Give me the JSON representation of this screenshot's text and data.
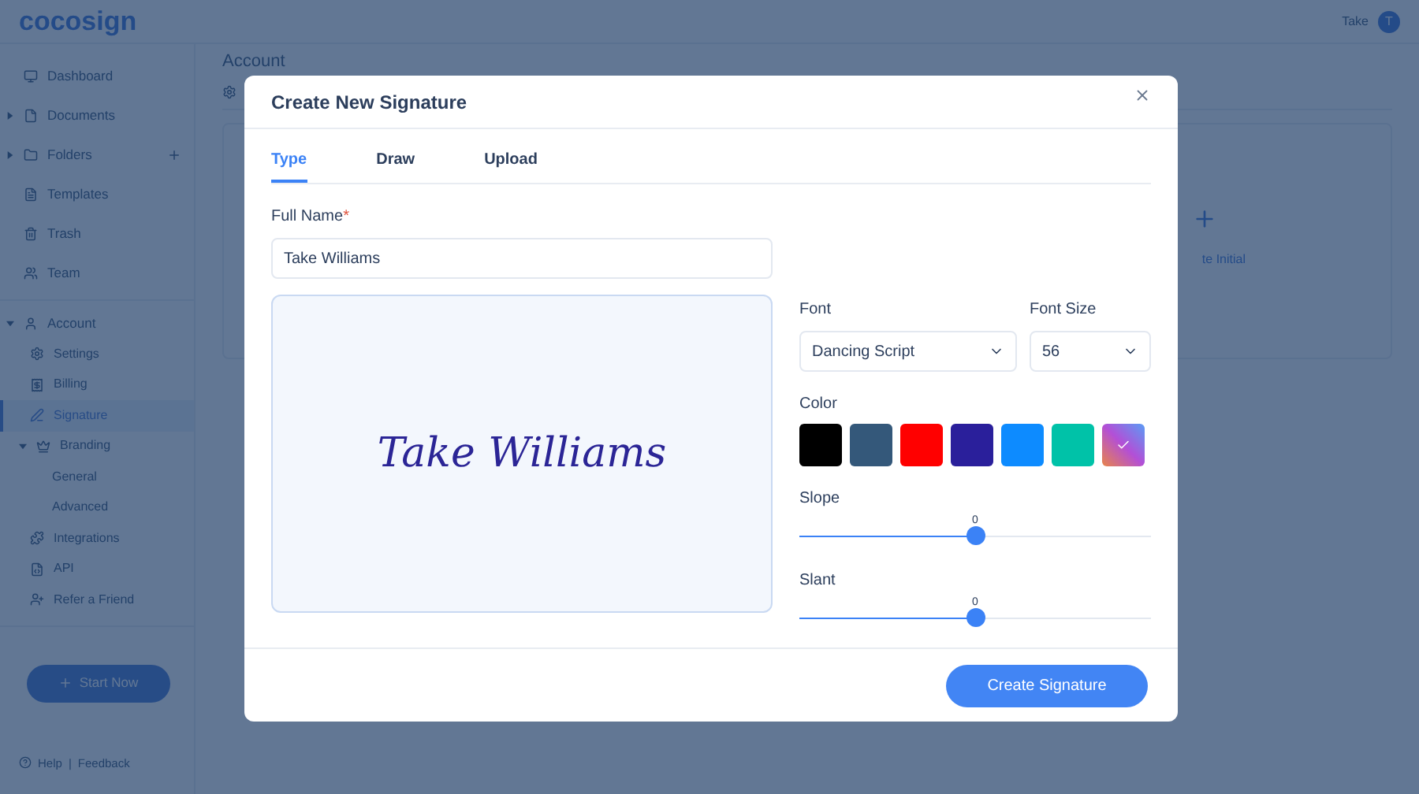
{
  "header": {
    "logo": "cocosign",
    "user_name": "Take",
    "avatar_initial": "T"
  },
  "sidebar": {
    "items": [
      {
        "label": "Dashboard",
        "selected": false
      },
      {
        "label": "Documents",
        "selected": false,
        "expanded": false
      },
      {
        "label": "Folders",
        "selected": false,
        "expanded": false,
        "add_button": true
      },
      {
        "label": "Templates",
        "selected": false
      },
      {
        "label": "Trash",
        "selected": false
      },
      {
        "label": "Team",
        "selected": false
      }
    ],
    "account": {
      "label": "Account",
      "expanded": true,
      "children": [
        {
          "label": "Settings",
          "selected": false
        },
        {
          "label": "Billing",
          "selected": false
        },
        {
          "label": "Signature",
          "selected": true
        },
        {
          "label": "Branding",
          "selected": false,
          "expanded": true,
          "children": [
            {
              "label": "General",
              "selected": false
            },
            {
              "label": "Advanced",
              "selected": false
            }
          ]
        },
        {
          "label": "Integrations",
          "selected": false
        },
        {
          "label": "API",
          "selected": false
        },
        {
          "label": "Refer a Friend",
          "selected": false
        }
      ]
    },
    "start_button": "Start Now",
    "footer_links": [
      "Help",
      "Feedback"
    ],
    "footer_separator": "|"
  },
  "page": {
    "title": "Account",
    "card_action": "te Initial"
  },
  "dialog": {
    "title": "Create New Signature",
    "tabs": [
      {
        "label": "Type",
        "selected": true
      },
      {
        "label": "Draw",
        "selected": false
      },
      {
        "label": "Upload",
        "selected": false
      }
    ],
    "full_name": {
      "label": "Full Name",
      "required_mark": "*",
      "value": "Take Williams"
    },
    "preview_text": "Take Williams",
    "font": {
      "label": "Font",
      "value": "Dancing Script"
    },
    "font_size": {
      "label": "Font Size",
      "value": "56"
    },
    "color": {
      "label": "Color",
      "swatches": [
        {
          "color": "#000000",
          "selected": false
        },
        {
          "color": "#34587a",
          "selected": false
        },
        {
          "color": "#ff0000",
          "selected": false
        },
        {
          "color": "#2a1f9b",
          "selected": false
        },
        {
          "color": "#0d8bff",
          "selected": false
        },
        {
          "color": "#00c2a8",
          "selected": false
        },
        {
          "color": "#b34fd6",
          "kind": "gradient",
          "selected": true
        }
      ]
    },
    "sliders": [
      {
        "label": "Slope",
        "reading": "0",
        "level": 0.5
      },
      {
        "label": "Slant",
        "reading": "0",
        "level": 0.5
      }
    ],
    "submit": "Create Signature"
  }
}
